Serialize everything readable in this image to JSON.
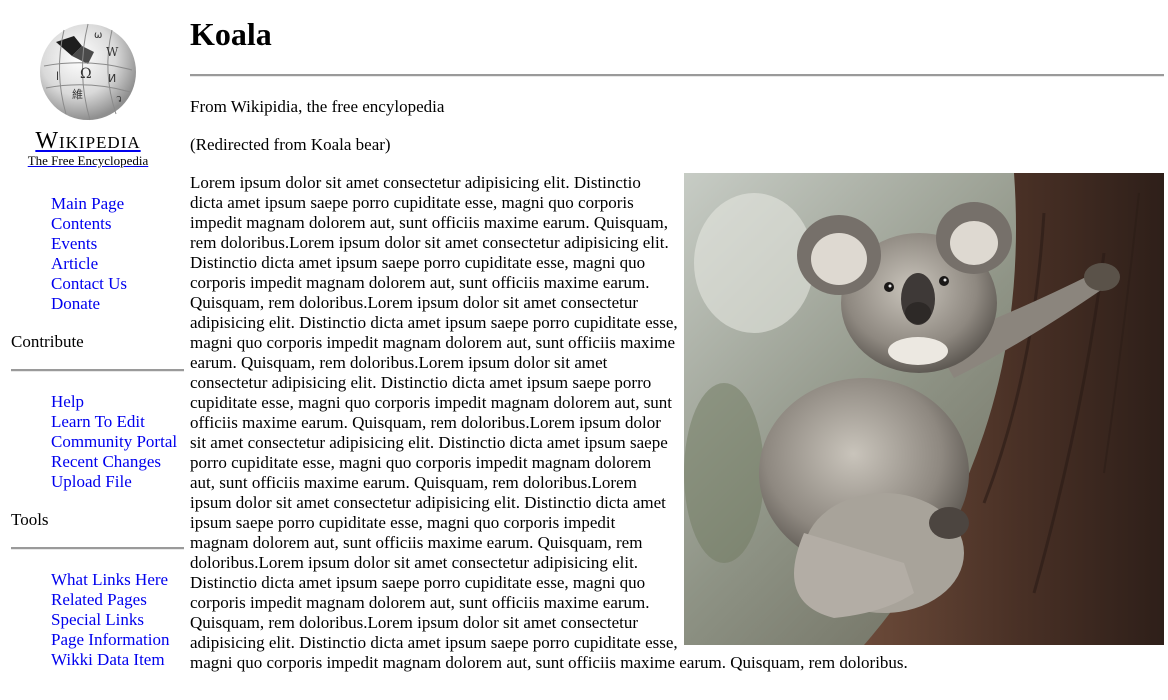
{
  "logo": {
    "wordmark": "Wikipedia",
    "tagline": "The Free Encyclopedia",
    "icon": "wikipedia-globe"
  },
  "nav": {
    "primary": [
      "Main Page",
      "Contents",
      "Events",
      "Article",
      "Contact Us",
      "Donate"
    ],
    "contribute": {
      "title": "Contribute",
      "items": [
        "Help",
        "Learn To Edit",
        "Community Portal",
        "Recent Changes",
        "Upload File"
      ]
    },
    "tools": {
      "title": "Tools",
      "items": [
        "What Links Here",
        "Related Pages",
        "Special Links",
        "Page Information",
        "Wikki Data Item"
      ]
    }
  },
  "article": {
    "title": "Koala",
    "subtitle": "From Wikipidia, the free encylopedia",
    "redirect": "(Redirected from Koala bear)",
    "body": "Lorem ipsum dolor sit amet consectetur adipisicing elit. Distinctio dicta amet ipsum saepe porro cupiditate esse, magni quo corporis impedit magnam dolorem aut, sunt officiis maxime earum. Quisquam, rem doloribus.Lorem ipsum dolor sit amet consectetur adipisicing elit. Distinctio dicta amet ipsum saepe porro cupiditate esse, magni quo corporis impedit magnam dolorem aut, sunt officiis maxime earum. Quisquam, rem doloribus.Lorem ipsum dolor sit amet consectetur adipisicing elit. Distinctio dicta amet ipsum saepe porro cupiditate esse, magni quo corporis impedit magnam dolorem aut, sunt officiis maxime earum. Quisquam, rem doloribus.Lorem ipsum dolor sit amet consectetur adipisicing elit. Distinctio dicta amet ipsum saepe porro cupiditate esse, magni quo corporis impedit magnam dolorem aut, sunt officiis maxime earum. Quisquam, rem doloribus.Lorem ipsum dolor sit amet consectetur adipisicing elit. Distinctio dicta amet ipsum saepe porro cupiditate esse, magni quo corporis impedit magnam dolorem aut, sunt officiis maxime earum. Quisquam, rem doloribus.Lorem ipsum dolor sit amet consectetur adipisicing elit. Distinctio dicta amet ipsum saepe porro cupiditate esse, magni quo corporis impedit magnam dolorem aut, sunt officiis maxime earum. Quisquam, rem doloribus.Lorem ipsum dolor sit amet consectetur adipisicing elit. Distinctio dicta amet ipsum saepe porro cupiditate esse, magni quo corporis impedit magnam dolorem aut, sunt officiis maxime earum. Quisquam, rem doloribus.Lorem ipsum dolor sit amet consectetur adipisicing elit. Distinctio dicta amet ipsum saepe porro cupiditate esse, magni quo corporis impedit magnam dolorem aut, sunt officiis maxime earum. Quisquam, rem doloribus."
  },
  "colors": {
    "link": "#0000ee",
    "rule": "#9a9a9a"
  }
}
